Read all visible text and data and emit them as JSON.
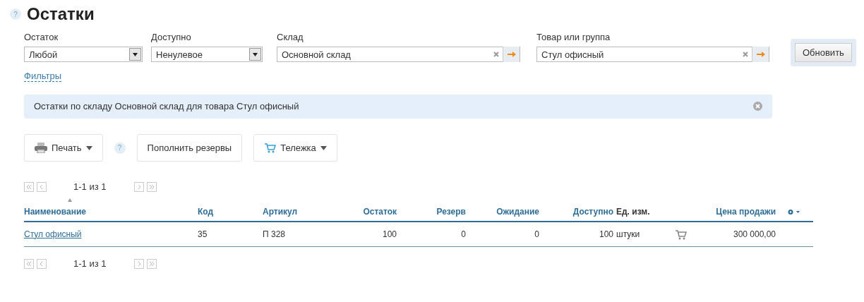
{
  "page": {
    "title": "Остатки",
    "help": "?"
  },
  "filters": [
    {
      "kind": "select",
      "label": "Остаток",
      "value": "Любой"
    },
    {
      "kind": "select",
      "label": "Доступно",
      "value": "Ненулевое"
    },
    {
      "kind": "lookup",
      "label": "Склад",
      "value": "Основной склад"
    },
    {
      "kind": "lookup",
      "label": "Товар или группа",
      "value": "Стул офисный"
    }
  ],
  "refresh_button": "Обновить",
  "filters_link": "Фильтры",
  "info_message": "Остатки по складу Основной склад для товара Стул офисный",
  "toolbar": [
    {
      "kind": "print",
      "label": "Печать",
      "dropdown": true
    },
    {
      "kind": "help",
      "label": "?"
    },
    {
      "kind": "plain",
      "label": "Пополнить резервы",
      "dropdown": false
    },
    {
      "kind": "cart",
      "label": "Тележка",
      "dropdown": true
    }
  ],
  "pager_top": {
    "text": "1-1 из 1"
  },
  "table": {
    "columns": [
      {
        "label": "Наименование",
        "sortable": true,
        "sorted": true
      },
      {
        "label": "Код",
        "sortable": true,
        "sorted": false
      },
      {
        "label": "Артикул",
        "sortable": true,
        "sorted": false
      },
      {
        "label": "Остаток",
        "sortable": true,
        "sorted": false
      },
      {
        "label": "Резерв",
        "sortable": true,
        "sorted": false
      },
      {
        "label": "Ожидание",
        "sortable": true,
        "sorted": false
      },
      {
        "label": "Доступно",
        "sortable": true,
        "sorted": false
      },
      {
        "label": "Ед. изм.",
        "sortable": false,
        "sorted": false
      },
      {
        "label": "Цена продажи",
        "sortable": true,
        "sorted": false
      }
    ],
    "rows": [
      {
        "name": "Стул офисный",
        "code": "35",
        "article": "П 328",
        "stock": "100",
        "reserve": "0",
        "expected": "0",
        "available": "100",
        "unit": "штуки",
        "price": "300 000,00"
      }
    ]
  },
  "pager_bottom": {
    "text": "1-1 из 1"
  }
}
